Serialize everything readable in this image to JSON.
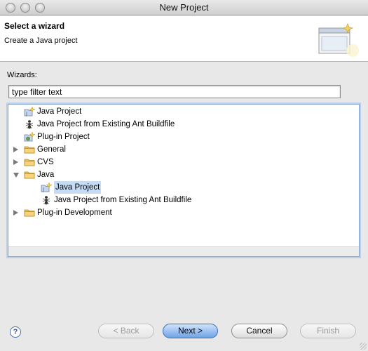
{
  "window": {
    "title": "New Project"
  },
  "header": {
    "title": "Select a wizard",
    "description": "Create a Java project"
  },
  "wizards": {
    "label": "Wizards:",
    "filter_value": "type filter text"
  },
  "tree": [
    {
      "label": "Java Project",
      "icon": "java-project-icon",
      "expander": "none",
      "depth": 0
    },
    {
      "label": "Java Project from Existing Ant Buildfile",
      "icon": "ant-icon",
      "expander": "none",
      "depth": 0
    },
    {
      "label": "Plug-in Project",
      "icon": "plugin-project-icon",
      "expander": "none",
      "depth": 0
    },
    {
      "label": "General",
      "icon": "folder-icon",
      "expander": "closed",
      "depth": 0
    },
    {
      "label": "CVS",
      "icon": "folder-icon",
      "expander": "closed",
      "depth": 0
    },
    {
      "label": "Java",
      "icon": "folder-icon",
      "expander": "open",
      "depth": 0
    },
    {
      "label": "Java Project",
      "icon": "java-project-icon",
      "expander": "none",
      "depth": 1,
      "selected": true
    },
    {
      "label": "Java Project from Existing Ant Buildfile",
      "icon": "ant-icon",
      "expander": "none",
      "depth": 1
    },
    {
      "label": "Plug-in Development",
      "icon": "folder-icon",
      "expander": "closed",
      "depth": 0
    }
  ],
  "buttons": {
    "help": "?",
    "back": "< Back",
    "next": "Next >",
    "cancel": "Cancel",
    "finish": "Finish"
  },
  "colors": {
    "selection": "#c6dcf5",
    "default_button": "#6fa2e6",
    "folder": "#e9b84a"
  }
}
